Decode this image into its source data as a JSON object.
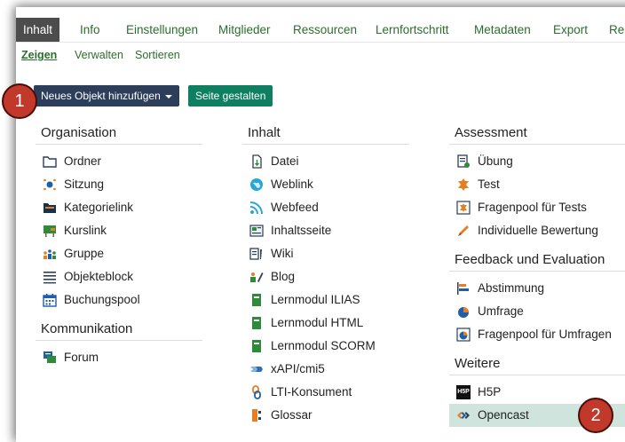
{
  "tabs": [
    "Inhalt",
    "Info",
    "Einstellungen",
    "Mitglieder",
    "Ressourcen",
    "Lernfortschritt",
    "Metadaten",
    "Export",
    "Re"
  ],
  "subtabs": [
    "Zeigen",
    "Verwalten",
    "Sortieren"
  ],
  "buttons": {
    "add_object": "Neues Objekt hinzufügen",
    "design_page": "Seite gestalten"
  },
  "col1": {
    "group1": {
      "title": "Organisation",
      "items": [
        "Ordner",
        "Sitzung",
        "Kategorielink",
        "Kurslink",
        "Gruppe",
        "Objekteblock",
        "Buchungspool"
      ]
    },
    "group2": {
      "title": "Kommunikation",
      "items": [
        "Forum"
      ]
    }
  },
  "col2": {
    "group1": {
      "title": "Inhalt",
      "items": [
        "Datei",
        "Weblink",
        "Webfeed",
        "Inhaltsseite",
        "Wiki",
        "Blog",
        "Lernmodul ILIAS",
        "Lernmodul HTML",
        "Lernmodul SCORM",
        "xAPI/cmi5",
        "LTI-Konsument",
        "Glossar"
      ]
    }
  },
  "col3": {
    "group1": {
      "title": "Assessment",
      "items": [
        "Übung",
        "Test",
        "Fragenpool für Tests",
        "Individuelle Bewertung"
      ]
    },
    "group2": {
      "title": "Feedback und Evaluation",
      "items": [
        "Abstimmung",
        "Umfrage",
        "Fragenpool für Umfragen"
      ]
    },
    "group3": {
      "title": "Weitere",
      "items": [
        "H5P",
        "Opencast"
      ]
    }
  },
  "h5p_logo": "H5P",
  "callouts": [
    "1",
    "2"
  ]
}
